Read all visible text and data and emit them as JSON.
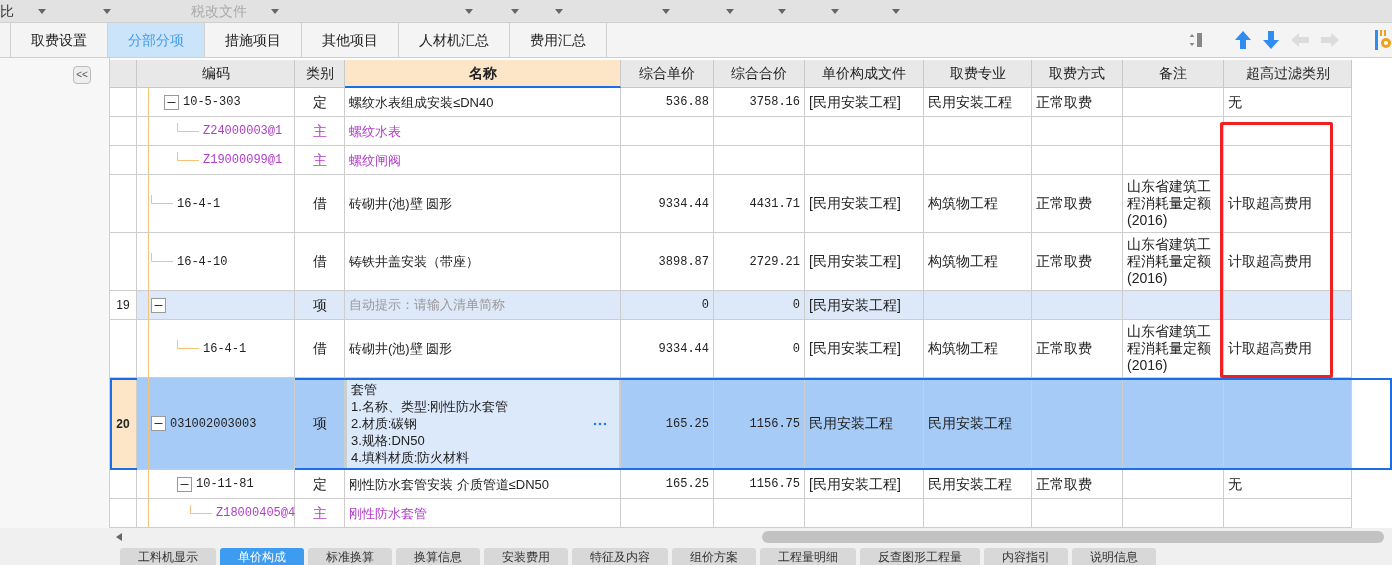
{
  "top_bar": {
    "items": [
      {
        "label": "比",
        "disabled": false
      },
      {
        "label": "税改文件",
        "disabled": true
      }
    ]
  },
  "tabs": [
    {
      "label": "取费设置",
      "selected": false
    },
    {
      "label": "分部分项",
      "selected": true
    },
    {
      "label": "措施项目",
      "selected": false
    },
    {
      "label": "其他项目",
      "selected": false
    },
    {
      "label": "人材机汇总",
      "selected": false
    },
    {
      "label": "费用汇总",
      "selected": false
    }
  ],
  "collapse_button": "<<",
  "table": {
    "columns": [
      {
        "selected": false
      },
      {
        "label": "编码",
        "selected": false
      },
      {
        "label": "类别",
        "selected": false
      },
      {
        "label": "名称",
        "selected": true
      },
      {
        "label": "综合单价",
        "selected": false
      },
      {
        "label": "综合合价",
        "selected": false
      },
      {
        "label": "单价构成文件",
        "selected": false
      },
      {
        "label": "取费专业",
        "selected": false
      },
      {
        "label": "取费方式",
        "selected": false
      },
      {
        "label": "备注",
        "selected": false
      },
      {
        "label": "超高过滤类别",
        "selected": false
      }
    ],
    "rows": [
      {
        "kind": "quota",
        "selected": false,
        "code": "10-5-303",
        "category": "定",
        "name": "螺纹水表组成安装≤DN40",
        "unit_price": "536.88",
        "total_price": "3758.16",
        "price_file": "[民用安装工程]",
        "fee_major": "民用安装工程",
        "fee_method": "正常取费",
        "filter_category": "无",
        "children": [
          {
            "kind": "material",
            "selected": false,
            "code": "Z24000003@1",
            "category": "主",
            "name": "螺纹水表"
          },
          {
            "kind": "material",
            "selected": false,
            "code": "Z19000099@1",
            "category": "主",
            "name": "螺纹闸阀"
          }
        ]
      },
      {
        "kind": "quota",
        "selected": false,
        "code": "16-4-1",
        "category": "借",
        "name": "砖砌井(池)壁 圆形",
        "unit_price": "9334.44",
        "total_price": "4431.71",
        "price_file": "[民用安装工程]",
        "fee_major": "构筑物工程",
        "fee_method": "正常取费",
        "remark": "山东省建筑工程消耗量定额(2016)",
        "filter_category": "计取超高费用"
      },
      {
        "kind": "quota",
        "selected": false,
        "code": "16-4-10",
        "category": "借",
        "name": "铸铁井盖安装（带座）",
        "unit_price": "3898.87",
        "total_price": "2729.21",
        "price_file": "[民用安装工程]",
        "fee_major": "构筑物工程",
        "fee_method": "正常取费",
        "remark": "山东省建筑工程消耗量定额(2016)",
        "filter_category": "计取超高费用"
      },
      {
        "kind": "bill",
        "selected": false,
        "row_number": "19",
        "category": "项",
        "placeholder": "自动提示：请输入清单简称",
        "unit_price": "0",
        "total_price": "0",
        "price_file": "[民用安装工程]",
        "children": [
          {
            "kind": "quota",
            "selected": false,
            "code": "16-4-1",
            "category": "借",
            "name": "砖砌井(池)壁 圆形",
            "unit_price": "9334.44",
            "total_price": "0",
            "price_file": "[民用安装工程]",
            "fee_major": "构筑物工程",
            "fee_method": "正常取费",
            "remark": "山东省建筑工程消耗量定额(2016)",
            "filter_category": "计取超高费用"
          }
        ]
      },
      {
        "kind": "bill",
        "selected": true,
        "row_number": "20",
        "code": "031002003003",
        "category": "项",
        "name": "套管\n1.名称、类型:刚性防水套管\n2.材质:碳钢\n3.规格:DN50\n4.填料材质:防火材料",
        "unit_price": "165.25",
        "total_price": "1156.75",
        "price_file": "民用安装工程",
        "fee_major": "民用安装工程",
        "children": [
          {
            "kind": "quota",
            "selected": false,
            "code": "10-11-81",
            "category": "定",
            "name": "刚性防水套管安装 介质管道≤DN50",
            "unit_price": "165.25",
            "total_price": "1156.75",
            "price_file": "[民用安装工程]",
            "fee_major": "民用安装工程",
            "fee_method": "正常取费",
            "filter_category": "无",
            "children": [
              {
                "kind": "material",
                "selected": false,
                "code": "Z18000405@4",
                "category": "主",
                "name": "刚性防水套管"
              }
            ]
          }
        ]
      }
    ]
  },
  "bottom_tabs": [
    {
      "label": "工料机显示",
      "selected": false
    },
    {
      "label": "单价构成",
      "selected": true
    },
    {
      "label": "标准换算",
      "selected": false
    },
    {
      "label": "换算信息",
      "selected": false
    },
    {
      "label": "安装费用",
      "selected": false
    },
    {
      "label": "特征及内容",
      "selected": false
    },
    {
      "label": "组价方案",
      "selected": false
    },
    {
      "label": "工程量明细",
      "selected": false
    },
    {
      "label": "反查图形工程量",
      "selected": false
    },
    {
      "label": "内容指引",
      "selected": false
    },
    {
      "label": "说明信息",
      "selected": false
    }
  ]
}
